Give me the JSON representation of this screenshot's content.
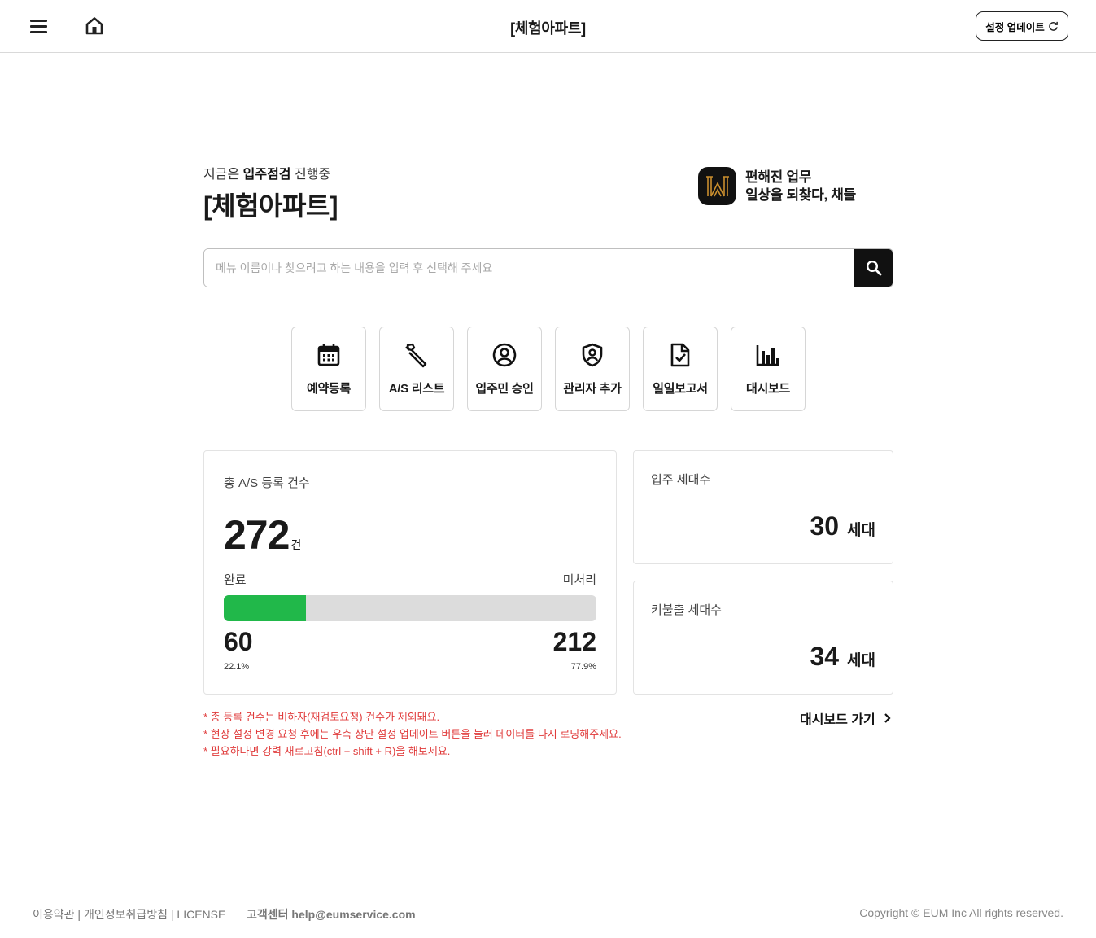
{
  "header": {
    "title": "[체험아파트]",
    "update_label": "설정 업데이트",
    "menu_icon": "hamburger-icon",
    "home_icon": "home-icon",
    "refresh_icon": "refresh-icon"
  },
  "hero": {
    "status_prefix": "지금은",
    "status_bold": "입주점검",
    "status_suffix": "진행중",
    "title": "[체험아파트]",
    "brand_line1": "편해진 업무",
    "brand_line2": "일상을 되찾다, 채들"
  },
  "search": {
    "placeholder": "메뉴 이름이나 찾으려고 하는 내용을 입력 후 선택해 주세요",
    "icon": "search-icon"
  },
  "quick_menu": [
    {
      "label": "예약등록",
      "icon": "calendar-icon"
    },
    {
      "label": "A/S 리스트",
      "icon": "wrench-icon"
    },
    {
      "label": "입주민 승인",
      "icon": "user-circle-icon"
    },
    {
      "label": "관리자 추가",
      "icon": "shield-user-icon"
    },
    {
      "label": "일일보고서",
      "icon": "document-check-icon"
    },
    {
      "label": "대시보드",
      "icon": "bar-chart-icon"
    }
  ],
  "as_stats": {
    "label": "총 A/S 등록 건수",
    "total": "272",
    "total_unit": "건",
    "done_label": "완료",
    "pending_label": "미처리",
    "done": "60",
    "pending": "212",
    "done_pct": "22.1%",
    "pending_pct": "77.9%",
    "done_fraction": 0.221,
    "bar_color": "#21b84a"
  },
  "households": {
    "label": "입주 세대수",
    "value": "30",
    "unit": "세대"
  },
  "key_households": {
    "label": "키불출 세대수",
    "value": "34",
    "unit": "세대"
  },
  "notes": [
    "* 총 등록 건수는 비하자(재검토요청) 건수가 제외돼요.",
    "* 현장 설정 변경 요청 후에는 우측 상단 설정 업데이트 버튼을 눌러 데이터를 다시 로딩해주세요.",
    "* 필요하다면 강력 새로고침(ctrl + shift + R)을 해보세요."
  ],
  "dashboard_link": "대시보드 가기",
  "footer": {
    "terms": "이용약관",
    "privacy": "개인정보취급방침",
    "license": "LICENSE",
    "sep": "|",
    "support_label": "고객센터",
    "support_email": "help@eumservice.com",
    "copyright": "Copyright © EUM Inc All rights reserved."
  },
  "colors": {
    "accent_green": "#21b84a",
    "note_red": "#e03b3b",
    "dark": "#111111"
  }
}
